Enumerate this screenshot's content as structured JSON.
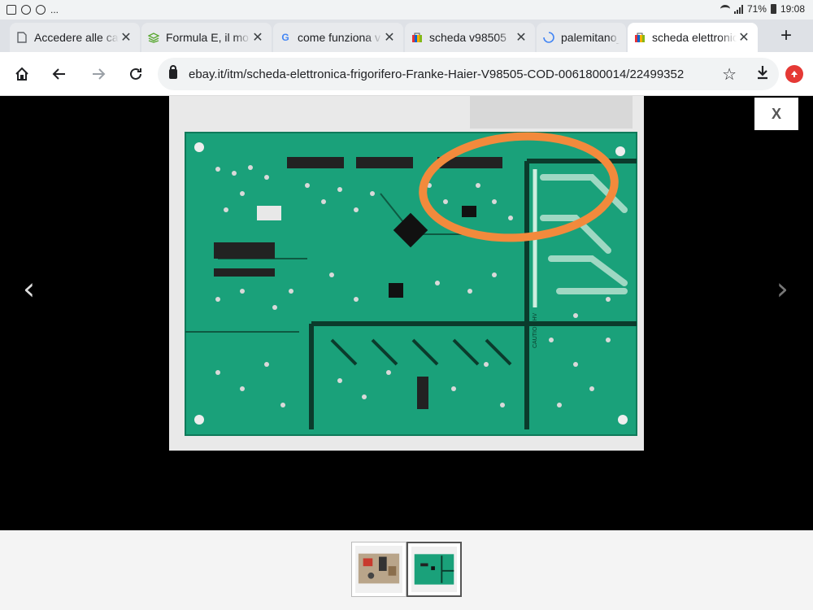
{
  "status_bar": {
    "battery": "71%",
    "time": "19:08",
    "more": "..."
  },
  "tabs": [
    {
      "title": "Accedere alle ca",
      "favicon": "document-icon",
      "active": false
    },
    {
      "title": "Formula E, il mo",
      "favicon": "layers-icon",
      "active": false
    },
    {
      "title": "come funziona v",
      "favicon": "google-icon",
      "active": false
    },
    {
      "title": "scheda v98505 ",
      "favicon": "ebay-bag-icon",
      "active": false
    },
    {
      "title": "palemitano_",
      "favicon": "loading-icon",
      "active": false
    },
    {
      "title": "scheda elettronic",
      "favicon": "ebay-bag-icon",
      "active": true
    }
  ],
  "toolbar": {
    "url": "ebay.it/itm/scheda-elettronica-frigorifero-Franke-Haier-V98505-COD-0061800014/22499352",
    "home_icon": "home-icon",
    "back_icon": "back-arrow-icon",
    "forward_icon": "forward-arrow-icon",
    "reload_icon": "reload-icon",
    "bookmark_icon": "star-icon",
    "download_icon": "download-icon"
  },
  "viewer": {
    "close_label": "X",
    "prev_icon": "chevron-left-icon",
    "next_icon": "chevron-right-icon",
    "board_label": "CAUTION HV"
  },
  "thumbnails": [
    {
      "selected": false
    },
    {
      "selected": true
    }
  ],
  "colors": {
    "pcb_green": "#1aa17a",
    "annotation_orange": "#f28a3c",
    "active_tab": "#ffffff",
    "tab_strip": "#dee1e6"
  }
}
